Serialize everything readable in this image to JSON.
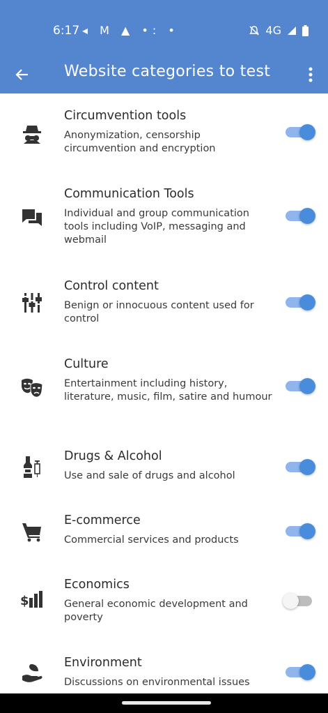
{
  "status_bar": {
    "time": "6:17",
    "left_icons": "◂ M ▲ •: •",
    "network": "4G"
  },
  "app_bar": {
    "title": "Website categories to test"
  },
  "colors": {
    "primary": "#5486cf",
    "toggle_on": "#4a8cdc",
    "toggle_off": "#f5f5f5"
  },
  "categories": [
    {
      "title": "Circumvention tools",
      "description": "Anonymization, censorship circumvention and encryption",
      "icon": "spy-icon",
      "enabled": true
    },
    {
      "title": "Communication Tools",
      "description": "Individual and group communication tools including VoIP, messaging and webmail",
      "icon": "chat-icon",
      "enabled": true
    },
    {
      "title": "Control content",
      "description": "Benign or innocuous content used for control",
      "icon": "sliders-icon",
      "enabled": true
    },
    {
      "title": "Culture",
      "description": "Entertainment including history, literature, music, film, satire and humour",
      "icon": "theater-masks-icon",
      "enabled": true
    },
    {
      "title": "Drugs & Alcohol",
      "description": "Use and sale of drugs and alcohol",
      "icon": "bottle-syringe-icon",
      "enabled": true
    },
    {
      "title": "E-commerce",
      "description": "Commercial services and products",
      "icon": "cart-icon",
      "enabled": true
    },
    {
      "title": "Economics",
      "description": "General economic development and poverty",
      "icon": "dollar-chart-icon",
      "enabled": false
    },
    {
      "title": "Environment",
      "description": "Discussions on environmental issues",
      "icon": "leaf-hand-icon",
      "enabled": true
    }
  ]
}
